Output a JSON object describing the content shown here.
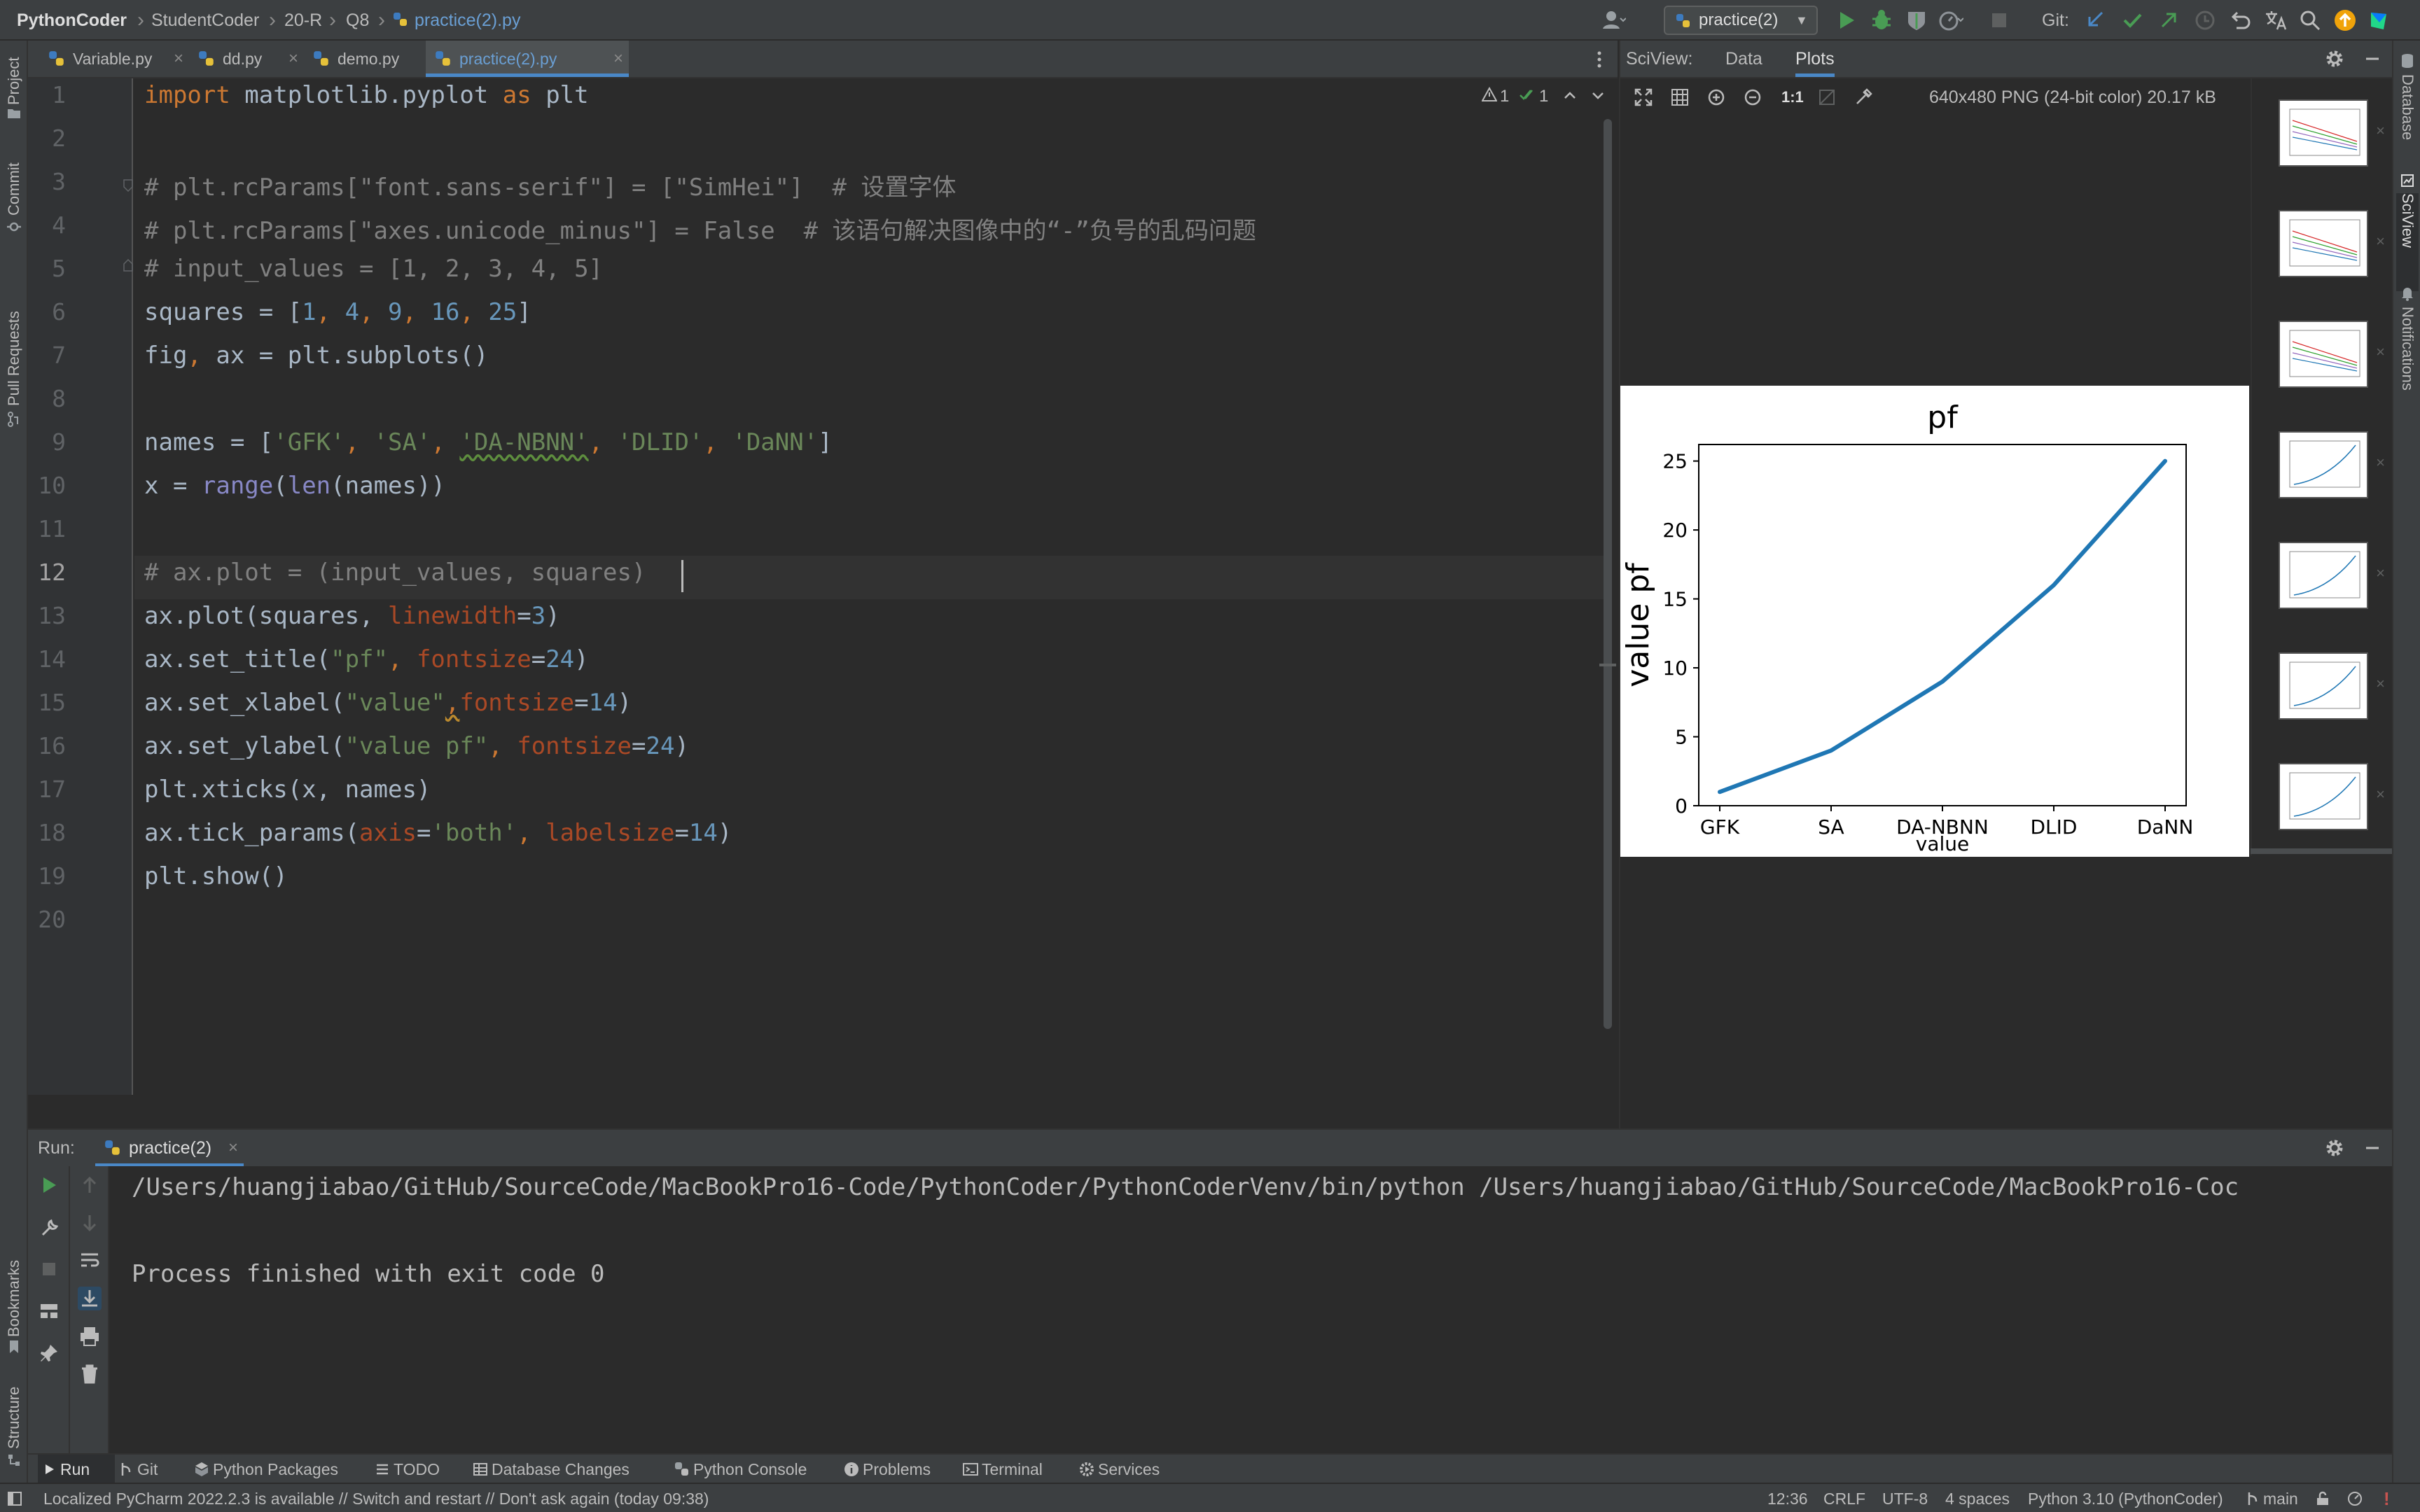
{
  "navbar": {
    "project": "PythonCoder",
    "crumbs": [
      "StudentCoder",
      "20-R",
      "Q8",
      "practice(2).py"
    ],
    "run_config": "practice(2)",
    "git_label": "Git:"
  },
  "left_tabs": [
    "Project",
    "Commit",
    "Pull Requests",
    "Bookmarks",
    "Structure"
  ],
  "right_tabs": [
    "Database",
    "SciView",
    "Notifications"
  ],
  "tabs": [
    {
      "label": "Variable.py",
      "active": false
    },
    {
      "label": "dd.py",
      "active": false
    },
    {
      "label": "demo.py",
      "active": false
    },
    {
      "label": "practice(2).py",
      "active": true
    }
  ],
  "editor": {
    "line_numbers": [
      "1",
      "2",
      "3",
      "4",
      "5",
      "6",
      "7",
      "8",
      "9",
      "10",
      "11",
      "12",
      "13",
      "14",
      "15",
      "16",
      "17",
      "18",
      "19",
      "20"
    ],
    "current_line": 12,
    "inspections": {
      "warnings": "1",
      "checks": "1"
    },
    "lines": {
      "l1": {
        "a": "import",
        "b": " matplotlib.pyplot ",
        "c": "as",
        "d": " plt"
      },
      "l3": "# plt.rcParams[\"font.sans-serif\"] = [\"SimHei\"]  # 设置字体",
      "l4": "# plt.rcParams[\"axes.unicode_minus\"] = False  # 该语句解决图像中的“-”负号的乱码问题",
      "l5": "# input_values = [1, 2, 3, 4, 5]",
      "l6": {
        "a": "squares = [",
        "n1": "1",
        "c1": ", ",
        "n2": "4",
        "c2": ", ",
        "n3": "9",
        "c3": ", ",
        "n4": "16",
        "c4": ", ",
        "n5": "25",
        "e": "]"
      },
      "l7": {
        "a": "fig",
        "b": ", ",
        "c": "ax = plt.subplots()"
      },
      "l9": {
        "a": "names = [",
        "s1": "'GFK'",
        "c1": ", ",
        "s2": "'SA'",
        "c2": ", ",
        "s3": "'DA-NBNN'",
        "c3": ", ",
        "s4": "'DLID'",
        "c4": ", ",
        "s5": "'DaNN'",
        "e": "]"
      },
      "l10": {
        "a": "x = ",
        "b": "range",
        "c": "(",
        "d": "len",
        "e": "(names))"
      },
      "l12": "# ax.plot = (input_values, squares)",
      "l13": {
        "a": "ax.plot(squares, ",
        "p": "linewidth",
        "eq": "=",
        "n": "3",
        "e": ")"
      },
      "l14": {
        "a": "ax.set_title(",
        "s": "\"pf\"",
        "c": ", ",
        "p": "fontsize",
        "eq": "=",
        "n": "24",
        "e": ")"
      },
      "l15": {
        "a": "ax.set_xlabel(",
        "s": "\"value\"",
        "c": ",",
        "p": "fontsize",
        "eq": "=",
        "n": "14",
        "e": ")"
      },
      "l16": {
        "a": "ax.set_ylabel(",
        "s": "\"value pf\"",
        "c": ", ",
        "p": "fontsize",
        "eq": "=",
        "n": "24",
        "e": ")"
      },
      "l17": "plt.xticks(x, names)",
      "l18": {
        "a": "ax.tick_params(",
        "p1": "axis",
        "eq1": "=",
        "s": "'both'",
        "c": ", ",
        "p2": "labelsize",
        "eq2": "=",
        "n": "14",
        "e": ")"
      },
      "l19": "plt.show()"
    }
  },
  "sciview": {
    "label": "SciView:",
    "tabs": [
      "Data",
      "Plots"
    ],
    "active_tab": "Plots",
    "zoom_actual": "1:1",
    "image_info": "640x480 PNG (24-bit color) 20.17 kB",
    "thumbnail_count": 7
  },
  "chart_data": {
    "type": "line",
    "title": "pf",
    "xlabel": "value",
    "ylabel": "value pf",
    "categories": [
      "GFK",
      "SA",
      "DA-NBNN",
      "DLID",
      "DaNN"
    ],
    "values": [
      1,
      4,
      9,
      16,
      25
    ],
    "yticks": [
      "0",
      "5",
      "10",
      "15",
      "20",
      "25"
    ],
    "ylim": [
      0,
      26.2
    ],
    "grid": false,
    "line_color": "#1f77b4"
  },
  "run": {
    "label": "Run:",
    "config": "practice(2)",
    "output": [
      "/Users/huangjiabao/GitHub/SourceCode/MacBookPro16-Code/PythonCoder/PythonCoderVenv/bin/python /Users/huangjiabao/GitHub/SourceCode/MacBookPro16-Coc",
      "",
      "Process finished with exit code 0"
    ]
  },
  "tool_windows": [
    "Run",
    "Git",
    "Python Packages",
    "TODO",
    "Database Changes",
    "Python Console",
    "Problems",
    "Terminal",
    "Services"
  ],
  "status": {
    "message": "Localized PyCharm 2022.2.3 is available // Switch and restart // Don't ask again (today 09:38)",
    "position": "12:36",
    "line_sep": "CRLF",
    "encoding": "UTF-8",
    "indent": "4 spaces",
    "interpreter": "Python 3.10 (PythonCoder)",
    "branch": "main"
  },
  "colors": {
    "accent": "#4a88c7",
    "run_green": "#499c54",
    "update_orange": "#f0a30a",
    "error_red": "#c75450"
  }
}
